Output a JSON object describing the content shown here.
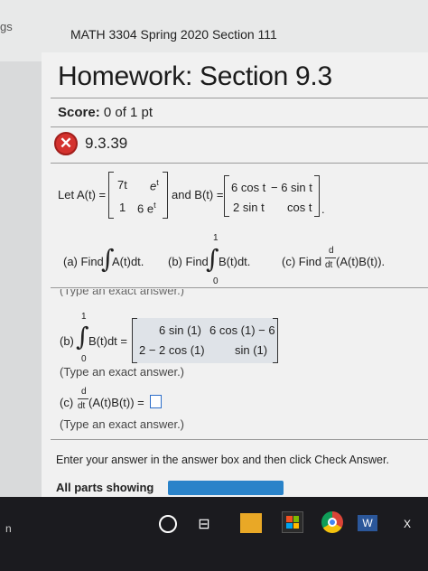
{
  "header": {
    "crumb": "gs",
    "course_title": "MATH 3304 Spring 2020 Section 111"
  },
  "homework": {
    "title": "Homework: Section 9.3"
  },
  "score": {
    "label": "Score:",
    "value": "0 of 1 pt"
  },
  "question": {
    "number": "9.3.39",
    "status_icon": "incorrect-x-icon"
  },
  "problem": {
    "let_a": "Let A(t) =",
    "a_r1c1": "7t",
    "a_r1c2": "e",
    "a_r1c2_sup": "t",
    "a_r2c1": "1",
    "a_r2c2": "6 e",
    "a_r2c2_sup": "t",
    "and_b": "and B(t) =",
    "b_r1c1": "6 cos t",
    "b_r1c2": "− 6 sin t",
    "b_r2c1": "2 sin t",
    "b_r2c2": "cos t",
    "period": "."
  },
  "parts": {
    "a": {
      "label": "(a) Find",
      "expr": "A(t)dt."
    },
    "b": {
      "label": "(b) Find",
      "upper": "1",
      "lower": "0",
      "expr": "B(t)dt."
    },
    "c": {
      "label": "(c) Find",
      "frac_top": "d",
      "frac_bottom": "dt",
      "expr": "(A(t)B(t))."
    }
  },
  "partial_hint": "(Type an exact answer.)",
  "answer_b": {
    "label": "(b)",
    "upper": "1",
    "lower": "0",
    "expr": "B(t)dt =",
    "r1c1": "6 sin (1)",
    "r1c2": "6 cos (1) − 6",
    "r2c1": "2 − 2 cos (1)",
    "r2c2": "sin (1)",
    "hint": "(Type an exact answer.)"
  },
  "answer_c": {
    "label": "(c)",
    "frac_top": "d",
    "frac_bottom": "dt",
    "expr": "(A(t)B(t)) =",
    "hint": "(Type an exact answer.)"
  },
  "instructions": "Enter your answer in the answer box and then click Check Answer.",
  "all_parts": "All parts showing",
  "taskbar": {
    "left_label": "n",
    "word_label": "W",
    "excel_label": "X"
  },
  "colors": {
    "incorrect": "#d4322e",
    "progress": "#2a83c9",
    "input_border": "#2d6ec9",
    "taskbar": "#1b1b1f"
  }
}
